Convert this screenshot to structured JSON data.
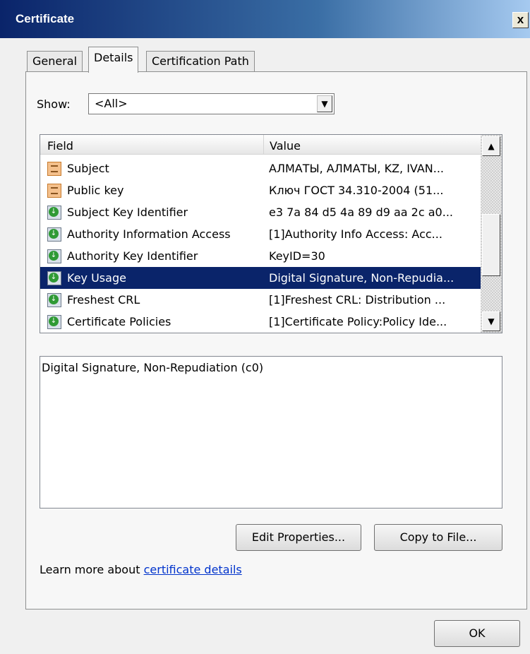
{
  "window": {
    "title": "Certificate",
    "close_label": "x"
  },
  "tabs": [
    {
      "label": "General",
      "active": false
    },
    {
      "label": "Details",
      "active": true
    },
    {
      "label": "Certification Path",
      "active": false
    }
  ],
  "show": {
    "label": "Show:",
    "selected": "<All>"
  },
  "fields_list": {
    "columns": [
      "Field",
      "Value"
    ],
    "rows": [
      {
        "field": "Subject",
        "value": "АЛМАТЫ, АЛМАТЫ, KZ, IVAN...",
        "icon": "certificate-field-icon",
        "selected": false
      },
      {
        "field": "Public key",
        "value": "Ключ ГОСТ 34.310-2004 (51...",
        "icon": "certificate-field-icon",
        "selected": false
      },
      {
        "field": "Subject Key Identifier",
        "value": "e3 7a 84 d5 4a 89 d9 aa 2c a0...",
        "icon": "extension-icon",
        "selected": false
      },
      {
        "field": "Authority Information Access",
        "value": "[1]Authority Info Access: Acc...",
        "icon": "extension-icon",
        "selected": false
      },
      {
        "field": "Authority Key Identifier",
        "value": "KeyID=30",
        "icon": "extension-icon",
        "selected": false
      },
      {
        "field": "Key Usage",
        "value": "Digital Signature, Non-Repudia...",
        "icon": "extension-icon",
        "selected": true
      },
      {
        "field": "Freshest CRL",
        "value": "[1]Freshest CRL: Distribution ...",
        "icon": "extension-icon",
        "selected": false
      },
      {
        "field": "Certificate Policies",
        "value": "[1]Certificate Policy:Policy Ide...",
        "icon": "extension-icon",
        "selected": false
      }
    ]
  },
  "detail_text": "Digital Signature, Non-Repudiation (c0)",
  "buttons": {
    "edit_properties": "Edit Properties...",
    "copy_to_file": "Copy to File...",
    "ok": "OK"
  },
  "learn_more": {
    "prefix": "Learn more about ",
    "link": "certificate details"
  },
  "colors": {
    "selection": "#0a246a",
    "link": "#0033cc"
  }
}
